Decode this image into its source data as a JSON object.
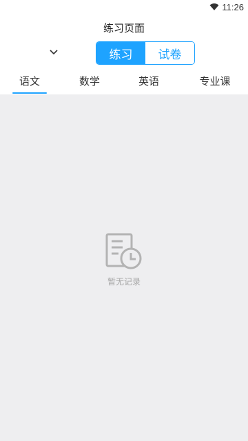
{
  "status": {
    "time": "11:26"
  },
  "header": {
    "title": "练习页面"
  },
  "segmented_control": {
    "options": [
      {
        "label": "练习",
        "active": true
      },
      {
        "label": "试卷",
        "active": false
      }
    ]
  },
  "tabs": [
    {
      "label": "语文",
      "selected": true
    },
    {
      "label": "数学",
      "selected": false
    },
    {
      "label": "英语",
      "selected": false
    },
    {
      "label": "专业课",
      "selected": false
    }
  ],
  "empty_state": {
    "icon": "document-clock-icon",
    "text": "暂无记录"
  },
  "colors": {
    "accent": "#1ea3ff",
    "content_bg": "#eeeef0",
    "empty_icon": "#b3b3b3"
  }
}
